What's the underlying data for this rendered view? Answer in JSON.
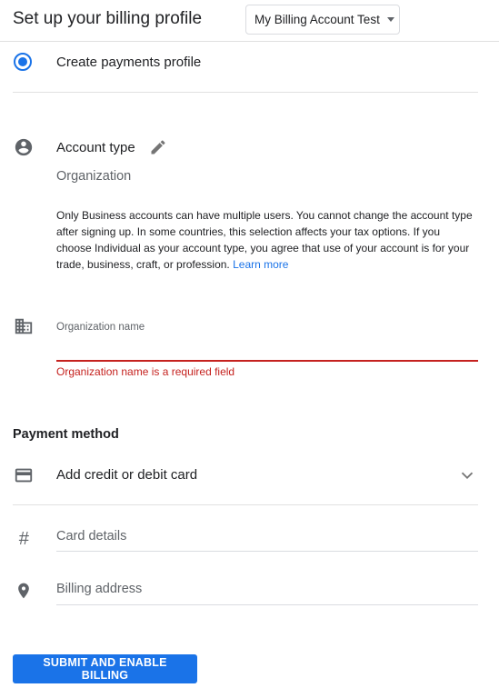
{
  "header": {
    "title": "Set up your billing profile",
    "account_selector": "My Billing Account Test"
  },
  "profile": {
    "option_label": "Create payments profile"
  },
  "account_type": {
    "label": "Account type",
    "value": "Organization",
    "description": "Only Business accounts can have multiple users. You cannot change the account type after signing up. In some countries, this selection affects your tax options. If you choose Individual as your account type, you agree that use of your account is for your trade, business, craft, or profession.",
    "learn_more": "Learn more"
  },
  "organization": {
    "label": "Organization name",
    "error": "Organization name is a required field"
  },
  "payment": {
    "section_title": "Payment method",
    "method_label": "Add credit or debit card",
    "card_placeholder": "Card details",
    "address_placeholder": "Billing address"
  },
  "submit": {
    "label": "SUBMIT AND ENABLE BILLING"
  },
  "colors": {
    "accent": "#1a73e8",
    "error": "#c5221f"
  },
  "icons": {
    "account": "person-circle-icon",
    "edit": "pencil-icon",
    "organization": "building-icon",
    "card": "credit-card-icon",
    "card_details": "hash-icon",
    "address": "location-pin-icon",
    "expand": "chevron-down-icon"
  }
}
